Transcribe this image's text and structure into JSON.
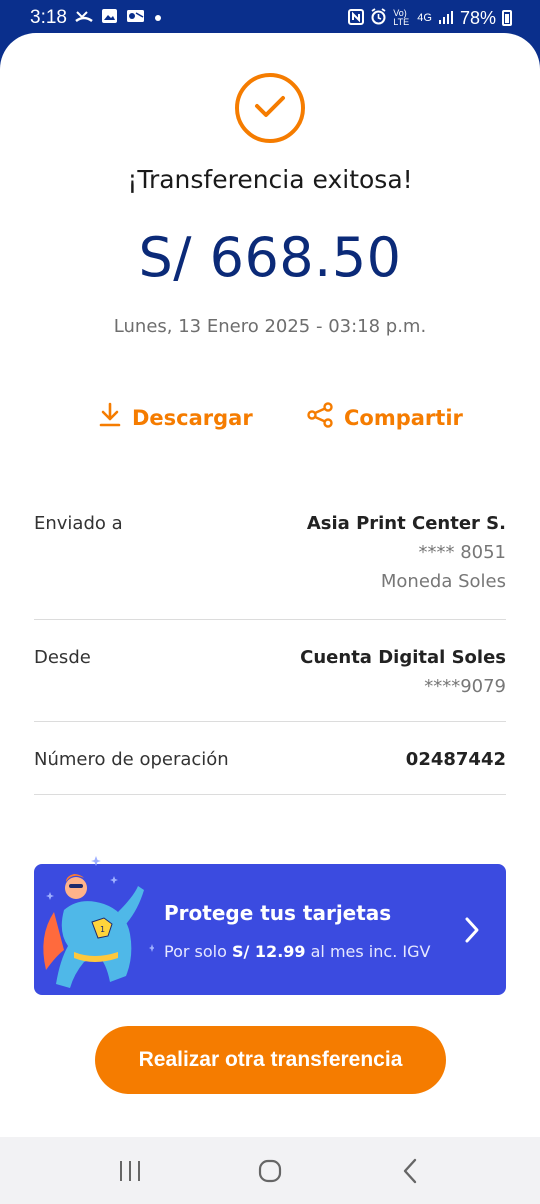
{
  "status_bar": {
    "time": "3:18",
    "battery": "78%",
    "left_icons": [
      "missed-call-icon",
      "image-icon",
      "outlook-icon",
      "dot-icon"
    ],
    "right_icons": [
      "nfc-icon",
      "alarm-icon",
      "volte-icon",
      "4g-icon",
      "signal-icon",
      "battery-icon"
    ],
    "volte_text": "Vo) LTE",
    "network_text": "4G"
  },
  "receipt": {
    "title": "¡Transferencia exitosa!",
    "amount": "S/ 668.50",
    "date": "Lunes, 13 Enero 2025 - 03:18 p.m."
  },
  "actions": {
    "download_label": "Descargar",
    "share_label": "Compartir"
  },
  "details": {
    "sent_to_label": "Enviado a",
    "sent_to_name": "Asia Print Center S.",
    "sent_to_account": "**** 8051",
    "sent_to_currency": "Moneda Soles",
    "from_label": "Desde",
    "from_account_name": "Cuenta Digital Soles",
    "from_account_number": "****9079",
    "operation_label": "Número de operación",
    "operation_number": "02487442"
  },
  "banner": {
    "title": "Protege tus tarjetas",
    "sub_prefix": "Por solo ",
    "sub_price": "S/ 12.99",
    "sub_suffix": " al mes inc. IGV"
  },
  "cta": {
    "label": "Realizar otra transferencia"
  },
  "colors": {
    "brand_blue": "#0a2f8c",
    "accent_orange": "#f57c00",
    "banner_blue": "#3b4be0"
  }
}
